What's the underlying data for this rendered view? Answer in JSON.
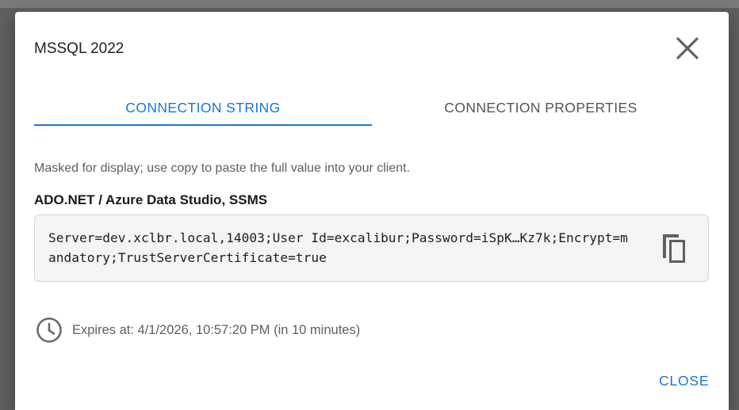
{
  "dialog": {
    "title": "MSSQL 2022",
    "tabs": [
      {
        "label": "CONNECTION STRING",
        "active": true
      },
      {
        "label": "CONNECTION PROPERTIES",
        "active": false
      }
    ],
    "note": "Masked for display; use copy to paste the full value into your client.",
    "section_label": "ADO.NET / Azure Data Studio, SSMS",
    "connection_string": "Server=dev.xclbr.local,14003;User Id=excalibur;Password=iSpK…Kz7k;Encrypt=mandatory;TrustServerCertificate=true",
    "expiry_text": "Expires at: 4/1/2026, 10:57:20 PM (in 10 minutes)",
    "close_label": "CLOSE"
  },
  "icons": {
    "close": "close-icon",
    "copy": "copy-icon",
    "clock": "clock-icon"
  },
  "colors": {
    "accent": "#1976d2",
    "muted_text": "#5f5f5f",
    "box_background": "#f4f4f4"
  }
}
